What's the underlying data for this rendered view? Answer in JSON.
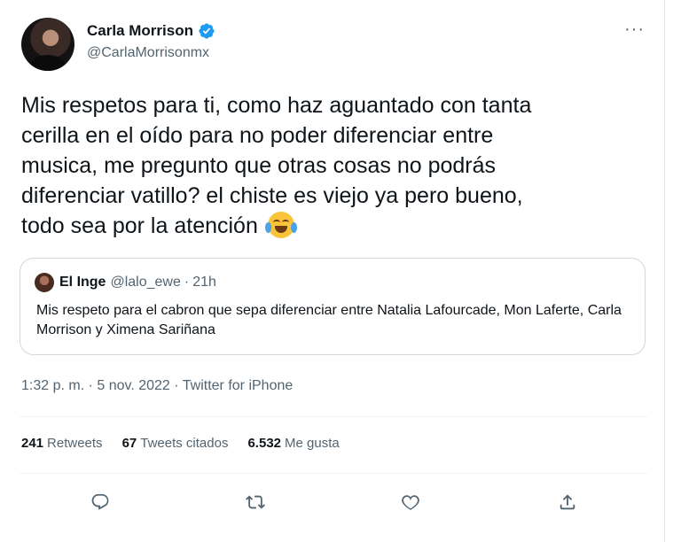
{
  "author": {
    "name": "Carla Morrison",
    "handle": "@CarlaMorrisonmx",
    "verified_color": "#1d9bf0"
  },
  "tweet": {
    "text": "Mis respetos para ti, como haz aguantado con tanta\ncerilla en el oído para no poder diferenciar entre\nmusica, me pregunto que otras cosas no podrás\ndiferenciar vatillo? el chiste es viejo ya pero bueno,\ntodo sea por la atención",
    "emoji": "face-with-tears-of-joy"
  },
  "quote": {
    "name": "El Inge",
    "handle": "@lalo_ewe",
    "separator": "·",
    "time": "21h",
    "text": "Mis respeto para el cabron que sepa diferenciar entre Natalia Lafourcade, Mon Laferte, Carla Morrison y Ximena Sariñana"
  },
  "meta": {
    "time": "1:32 p. m.",
    "date": "5 nov. 2022",
    "source": "Twitter for iPhone",
    "separator": "·"
  },
  "stats": {
    "retweets_count": "241",
    "retweets_label": "Retweets",
    "quotes_count": "67",
    "quotes_label": "Tweets citados",
    "likes_count": "6.532",
    "likes_label": "Me gusta"
  },
  "actions": [
    "reply-icon",
    "retweet-icon",
    "like-icon",
    "share-icon"
  ],
  "colors": {
    "text_primary": "#0f1419",
    "text_secondary": "#536471",
    "border": "#cfd9de",
    "verified": "#1d9bf0"
  }
}
